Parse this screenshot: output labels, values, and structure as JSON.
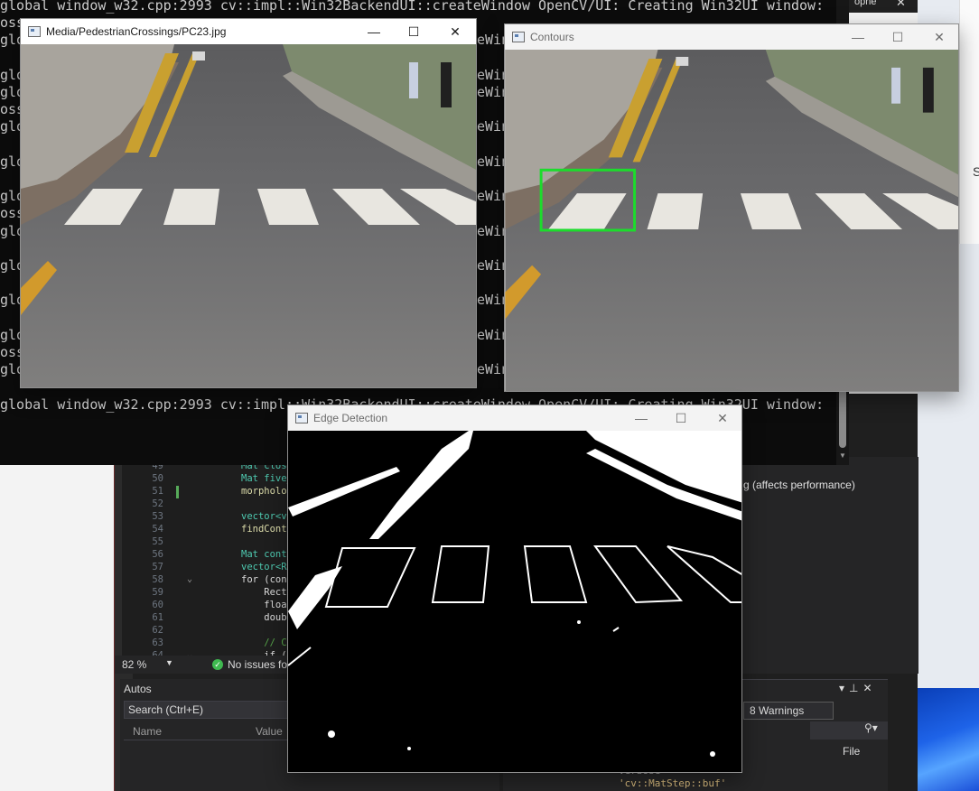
{
  "console": {
    "lines": [
      "global window_w32.cpp:2993 cv::impl::Win32BackendUI::createWindow OpenCV/UI: Creating Win32UI window:",
      "oss",
      "glo",
      "",
      "glo",
      "glo",
      "oss",
      "glo",
      "",
      "glo",
      "",
      "glo",
      "oss",
      "glo",
      "",
      "glo",
      "",
      "glo",
      "",
      "glo",
      "oss",
      "glo",
      "",
      "global window_w32.cpp:2993 cv::impl::Win32BackendUI::createWindow OpenCV/UI: Creating Win32UI window:"
    ],
    "right_fragment": "eWin",
    "tab_label": "ophe",
    "tab_close": "✕"
  },
  "windows": {
    "original": {
      "title": "Media/PedestrianCrossings/PC23.jpg"
    },
    "contours": {
      "title": "Contours"
    },
    "edges": {
      "title": "Edge Detection"
    },
    "controls": {
      "minimize": "—",
      "maximize": "☐",
      "close": "✕"
    }
  },
  "editor": {
    "lines": [
      {
        "num": "49",
        "text": "Mat close"
      },
      {
        "num": "50",
        "text": "Mat five_"
      },
      {
        "num": "51",
        "text": "morpholog"
      },
      {
        "num": "52",
        "text": ""
      },
      {
        "num": "53",
        "text": "vector<ve"
      },
      {
        "num": "54",
        "text": "findConto"
      },
      {
        "num": "55",
        "text": ""
      },
      {
        "num": "56",
        "text": "Mat conto"
      },
      {
        "num": "57",
        "text": "vector<Re"
      },
      {
        "num": "58",
        "text": "for (cons"
      },
      {
        "num": "59",
        "text": "    Rect"
      },
      {
        "num": "60",
        "text": "    float"
      },
      {
        "num": "61",
        "text": "    doubl"
      },
      {
        "num": "62",
        "text": ""
      },
      {
        "num": "63",
        "text": "    // Ch"
      },
      {
        "num": "64",
        "text": "    if ("
      }
    ],
    "zoom": "82 %",
    "status": "No issues fou",
    "option_text": "g (affects performance)"
  },
  "autos": {
    "title": "Autos",
    "search_placeholder": "Search (Ctrl+E)",
    "col_name": "Name",
    "col_value": "Value"
  },
  "errors": {
    "warnings": "8 Warnings",
    "file_col": "File",
    "row1": "'cv::MatStep::buf'",
    "row1_prefix": "Verbose"
  },
  "desktop": {
    "side_letter": "S"
  }
}
